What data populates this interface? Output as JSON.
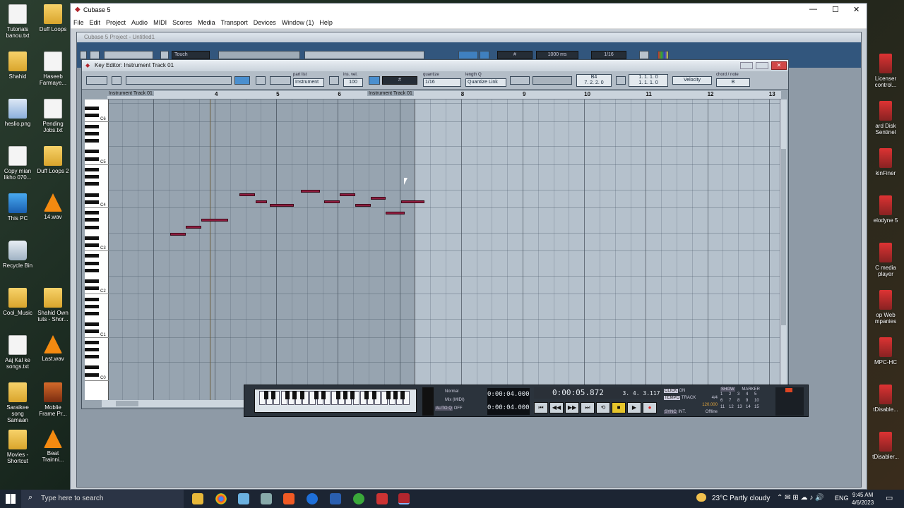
{
  "desktop_left": [
    {
      "label": "Tutorials banou.txt",
      "type": "doc"
    },
    {
      "label": "Duff Loops",
      "type": "fold"
    },
    {
      "label": "Shahid",
      "type": "fold"
    },
    {
      "label": "Haseeb Farmaye...",
      "type": "doc"
    },
    {
      "label": "heslio.png",
      "type": "img"
    },
    {
      "label": "Pending Jobs.txt",
      "type": "doc"
    },
    {
      "label": "Copy mian likho 070...",
      "type": "doc"
    },
    {
      "label": "Duff Loops 2",
      "type": "fold"
    },
    {
      "label": "This PC",
      "type": "pc"
    },
    {
      "label": "14.wav",
      "type": "vlc"
    },
    {
      "label": "Recycle Bin",
      "type": "bin"
    },
    {
      "label": "Cool_Music",
      "type": "fold"
    },
    {
      "label": "Shahid Own tuts - Shor...",
      "type": "fold"
    },
    {
      "label": "Aaj Kal ke songs.txt",
      "type": "doc"
    },
    {
      "label": "Last.wav",
      "type": "vlc"
    },
    {
      "label": "Saraikee song Samaan",
      "type": "fold"
    },
    {
      "label": "Moblie Frame Pr...",
      "type": "mv"
    },
    {
      "label": "Movies - Shortcut",
      "type": "fold"
    },
    {
      "label": "Beat Trainni...",
      "type": "vlc"
    }
  ],
  "desktop_right": [
    {
      "label": "Licenser control..."
    },
    {
      "label": "ard Disk Sentinel"
    },
    {
      "label": "kinFiner"
    },
    {
      "label": "elodyne 5"
    },
    {
      "label": "C media player"
    },
    {
      "label": "op Web mpanies"
    },
    {
      "label": "MPC-HC"
    },
    {
      "label": "tDisable..."
    },
    {
      "label": "tDisabler..."
    }
  ],
  "window": {
    "title": "Cubase 5",
    "menu": [
      "File",
      "Edit",
      "Project",
      "Audio",
      "MIDI",
      "Scores",
      "Media",
      "Transport",
      "Devices",
      "Window (1)",
      "Help"
    ],
    "minimize": "—",
    "maximize": "☐",
    "close": "✕"
  },
  "project": {
    "title": "Cubase 5 Project - Untitled1",
    "automation_mode": "Touch",
    "nudge": "1000 ms",
    "quantize": "1/16"
  },
  "key_editor": {
    "title": "Key Editor: Instrument Track 01",
    "part_list_label": "part list",
    "part_list_value": "Instrument",
    "insert_vel_label": "ins. vel.",
    "insert_vel_value": "100",
    "quantize_label": "quantize",
    "quantize_value": "1/16",
    "length_q_label": "length Q",
    "length_q_value": "Quantize Link",
    "pos_note": "B4",
    "pos_value": "7. 2. 2. 0",
    "grid_pos1": "1. 1. 1.  0",
    "grid_pos2": "1. 1. 1.  0",
    "controller": "Velocity",
    "chord_label": "chord / note",
    "chord_value": "B",
    "ruler_marks": [
      "4",
      "5",
      "6",
      "8",
      "9",
      "10",
      "11",
      "12",
      "13"
    ],
    "part_label_1": "Instrument Track 01",
    "part_label_2": "Instrument Track 01",
    "octaves": [
      "C6",
      "C5",
      "C4",
      "C3",
      "C2",
      "C1",
      "C0"
    ]
  },
  "notes": [
    {
      "start": 0.5,
      "len": 0.25,
      "pitch": 40
    },
    {
      "start": 0.75,
      "len": 0.25,
      "pitch": 42
    },
    {
      "start": 1.0,
      "len": 0.44,
      "pitch": 44
    },
    {
      "start": 1.62,
      "len": 0.25,
      "pitch": 51
    },
    {
      "start": 1.88,
      "len": 0.19,
      "pitch": 49
    },
    {
      "start": 2.12,
      "len": 0.38,
      "pitch": 48
    },
    {
      "start": 2.62,
      "len": 0.31,
      "pitch": 52
    },
    {
      "start": 3.0,
      "len": 0.25,
      "pitch": 49
    },
    {
      "start": 3.25,
      "len": 0.25,
      "pitch": 51
    },
    {
      "start": 3.5,
      "len": 0.25,
      "pitch": 48
    },
    {
      "start": 3.75,
      "len": 0.25,
      "pitch": 50
    },
    {
      "start": 4.0,
      "len": 0.31,
      "pitch": 46
    },
    {
      "start": 4.25,
      "len": 0.38,
      "pitch": 49
    }
  ],
  "transport": {
    "mode": "Normal",
    "mix": "Mix (MIDI)",
    "auto_q": "AUTO Q",
    "auto_q_state": "OFF",
    "left_locator": "0:00:04.000",
    "right_locator": "0:00:04.000",
    "time": "0:00:05.872",
    "bars": "3. 4. 3.117",
    "click": "CLICK",
    "click_state": "ON",
    "tempo": "TEMPO",
    "track": "TRACK",
    "signature": "4/4",
    "bpm": "120.000",
    "sync": "SYNC",
    "int": "INT.",
    "offline": "Offline",
    "show": "SHOW",
    "marker": "MARKER",
    "markers": [
      "1",
      "2",
      "3",
      "4",
      "5",
      "6",
      "7",
      "8",
      "9",
      "10",
      "11",
      "12",
      "13",
      "14",
      "15"
    ]
  },
  "taskbar": {
    "search_placeholder": "Type here to search",
    "weather": "23°C  Partly cloudy",
    "lang": "ENG",
    "time": "9:45 AM",
    "date": "4/6/2023"
  }
}
